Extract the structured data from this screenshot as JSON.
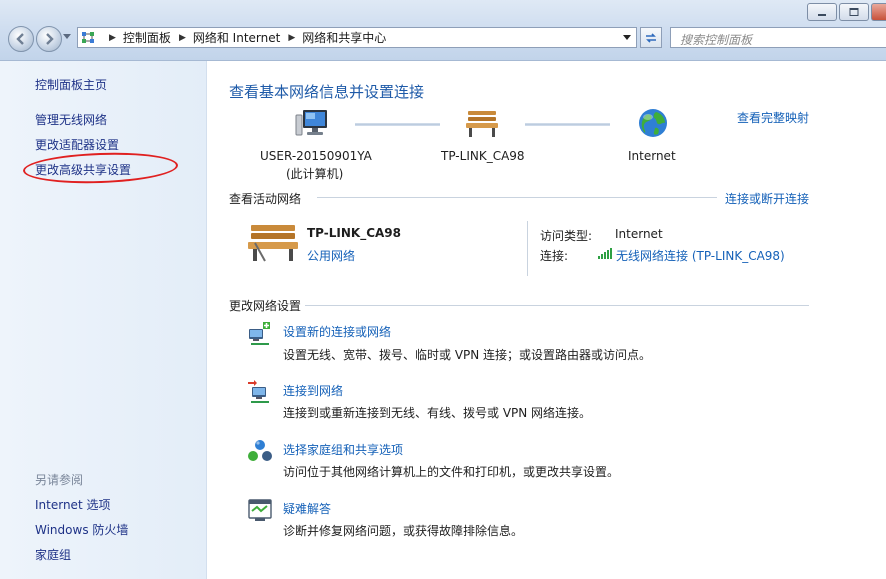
{
  "window": {
    "title": "网络和共享中心"
  },
  "address": {
    "crumbs": [
      "控制面板",
      "网络和 Internet",
      "网络和共享中心"
    ],
    "search_placeholder": "搜索控制面板"
  },
  "sidebar": {
    "home": "控制面板主页",
    "items": [
      "管理无线网络",
      "更改适配器设置",
      "更改高级共享设置"
    ],
    "see_also_heading": "另请参阅",
    "see_also": [
      "Internet 选项",
      "Windows 防火墙",
      "家庭组"
    ]
  },
  "main": {
    "title": "查看基本网络信息并设置连接",
    "full_map_link": "查看完整映射",
    "nodes": [
      {
        "label": "USER-20150901YA",
        "sublabel": "(此计算机)",
        "icon": "computer-icon"
      },
      {
        "label": "TP-LINK_CA98",
        "icon": "bench-icon"
      },
      {
        "label": "Internet",
        "icon": "globe-icon"
      }
    ],
    "active_networks": {
      "heading": "查看活动网络",
      "connect_link": "连接或断开连接",
      "network_name": "TP-LINK_CA98",
      "network_type": "公用网络",
      "access_type_label": "访问类型:",
      "access_type_value": "Internet",
      "connection_label": "连接:",
      "connection_value": "无线网络连接 (TP-LINK_CA98)"
    },
    "change_settings": {
      "heading": "更改网络设置",
      "tasks": [
        {
          "title": "设置新的连接或网络",
          "desc": "设置无线、宽带、拨号、临时或 VPN 连接；或设置路由器或访问点。",
          "icon": "new-connection-icon"
        },
        {
          "title": "连接到网络",
          "desc": "连接到或重新连接到无线、有线、拨号或 VPN 网络连接。",
          "icon": "connect-network-icon"
        },
        {
          "title": "选择家庭组和共享选项",
          "desc": "访问位于其他网络计算机上的文件和打印机，或更改共享设置。",
          "icon": "homegroup-icon"
        },
        {
          "title": "疑难解答",
          "desc": "诊断并修复网络问题，或获得故障排除信息。",
          "icon": "troubleshoot-icon"
        }
      ]
    }
  },
  "colors": {
    "link": "#1561b8",
    "title": "#1e5aa8",
    "annotation": "#e02020"
  }
}
